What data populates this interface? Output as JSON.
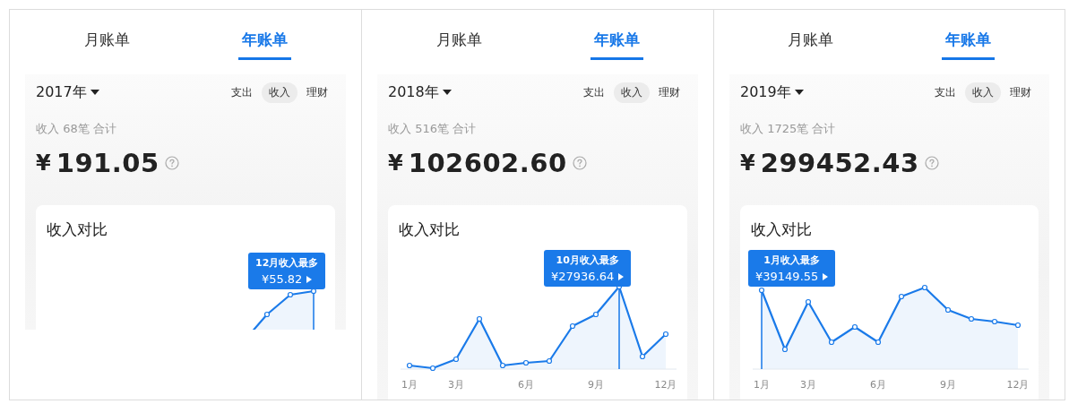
{
  "panels": [
    {
      "tabs": [
        {
          "label": "月账单",
          "selected": false
        },
        {
          "label": "年账单",
          "selected": true
        }
      ],
      "year": "2017年",
      "filters": [
        {
          "label": "支出",
          "selected": false
        },
        {
          "label": "收入",
          "selected": true
        },
        {
          "label": "理财",
          "selected": false
        }
      ],
      "summary": "收入 68笔 合计",
      "currency": "¥",
      "amount": "191.05",
      "card": {
        "title": "收入对比",
        "tooltip": {
          "title": "12月收入最多",
          "value": "¥55.82"
        }
      }
    },
    {
      "tabs": [
        {
          "label": "月账单",
          "selected": false
        },
        {
          "label": "年账单",
          "selected": true
        }
      ],
      "year": "2018年",
      "filters": [
        {
          "label": "支出",
          "selected": false
        },
        {
          "label": "收入",
          "selected": true
        },
        {
          "label": "理财",
          "selected": false
        }
      ],
      "summary": "收入 516笔 合计",
      "currency": "¥",
      "amount": "102602.60",
      "card": {
        "title": "收入对比",
        "tooltip": {
          "title": "10月收入最多",
          "value": "¥27936.64"
        },
        "x_labels": [
          "1月",
          "3月",
          "6月",
          "9月",
          "12月"
        ]
      }
    },
    {
      "tabs": [
        {
          "label": "月账单",
          "selected": false
        },
        {
          "label": "年账单",
          "selected": true
        }
      ],
      "year": "2019年",
      "filters": [
        {
          "label": "支出",
          "selected": false
        },
        {
          "label": "收入",
          "selected": true
        },
        {
          "label": "理财",
          "selected": false
        }
      ],
      "summary": "收入 1725笔 合计",
      "currency": "¥",
      "amount": "299452.43",
      "card": {
        "title": "收入对比",
        "tooltip": {
          "title": "1月收入最多",
          "value": "¥39149.55"
        },
        "x_labels": [
          "1月",
          "3月",
          "6月",
          "9月",
          "12月"
        ]
      }
    }
  ]
}
